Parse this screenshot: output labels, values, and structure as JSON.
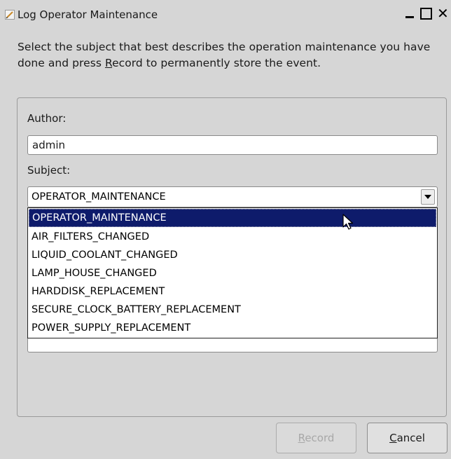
{
  "window": {
    "title": "Log Operator Maintenance",
    "icon": "pencil-icon"
  },
  "instructions": {
    "before_mnemonic": "Select the subject that best describes the operation maintenance you have done and press ",
    "mnemonic": "R",
    "after_mnemonic": "ecord to permanently store the event."
  },
  "form": {
    "author_label": "Author:",
    "author_value": "admin",
    "subject_label": "Subject:",
    "subject_value": "OPERATOR_MAINTENANCE"
  },
  "dropdown": {
    "options": [
      "OPERATOR_MAINTENANCE",
      "AIR_FILTERS_CHANGED",
      "LIQUID_COOLANT_CHANGED",
      "LAMP_HOUSE_CHANGED",
      "HARDDISK_REPLACEMENT",
      "SECURE_CLOCK_BATTERY_REPLACEMENT",
      "POWER_SUPPLY_REPLACEMENT"
    ],
    "selected_index": 0
  },
  "buttons": {
    "record_mnemonic": "R",
    "record_rest": "ecord",
    "record_enabled": false,
    "cancel_mnemonic": "C",
    "cancel_rest": "ancel"
  },
  "colors": {
    "selection": "#0e1b6b",
    "window_bg": "#d6d6d6"
  }
}
